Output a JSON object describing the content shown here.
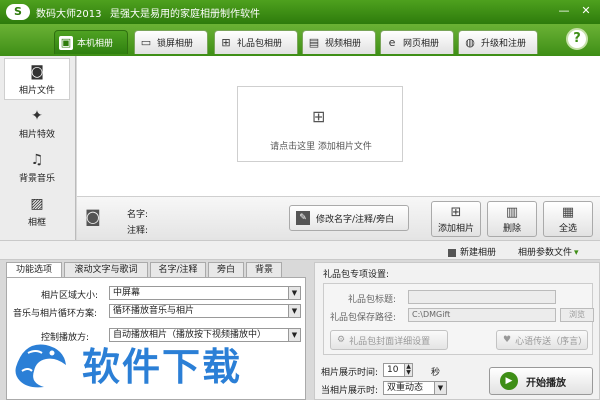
{
  "window": {
    "app_name": "数码大师2013",
    "slogan": "是强大是易用的家庭相册制作软件",
    "minimize": "—",
    "close": "✕"
  },
  "tabs": [
    {
      "label": "本机相册",
      "icon": "photo-album-icon",
      "active": true
    },
    {
      "label": "锁屏相册",
      "icon": "monitor-icon",
      "active": false
    },
    {
      "label": "礼品包相册",
      "icon": "gift-icon",
      "active": false
    },
    {
      "label": "视频相册",
      "icon": "film-icon",
      "active": false
    },
    {
      "label": "网页相册",
      "icon": "browser-icon",
      "active": false
    },
    {
      "label": "升级和注册",
      "icon": "globe-icon",
      "active": false
    }
  ],
  "help": "?",
  "sidebar": {
    "items": [
      {
        "label": "相片文件",
        "icon": "camera-icon",
        "active": true
      },
      {
        "label": "相片特效",
        "icon": "effects-icon",
        "active": false
      },
      {
        "label": "背景音乐",
        "icon": "music-icon",
        "active": false
      },
      {
        "label": "相框",
        "icon": "frame-icon",
        "active": false
      }
    ]
  },
  "dropzone": {
    "text": "请点击这里  添加相片文件"
  },
  "info": {
    "name_label": "名字:",
    "note_label": "注释:",
    "edit_button": "修改名字/注释/旁白",
    "add_photo": "添加相片",
    "delete": "删除",
    "select_all": "全选"
  },
  "sepbar": {
    "new_album": "新建相册",
    "album_params": "相册参数文件"
  },
  "bottom_left": {
    "tabs": [
      "功能选项",
      "滚动文字与歌词",
      "名字/注释",
      "旁白",
      "背景"
    ],
    "size_label": "相片区域大小:",
    "size_value": "中屏幕",
    "loop_label": "音乐与相片循环方案:",
    "loop_value": "循环播放音乐与相片",
    "control_label": "控制播放方:",
    "control_value": "自动播放相片（播放按下视频播放中）"
  },
  "bottom_right": {
    "title": "礼品包专项设置:",
    "gift_title_label": "礼品包标题:",
    "gift_title_value": "",
    "save_path_label": "礼品包保存路径:",
    "save_path_value": "C:\\DMGift",
    "browse": "浏览",
    "cover_button": "礼品包封面详细设置",
    "wish_button": "心语传送（序言）",
    "duration_label": "相片展示时间:",
    "duration_value": "10",
    "duration_unit": "秒",
    "transition_label": "当相片展示时:",
    "transition_value": "双重动态",
    "play_button": "开始播放"
  },
  "watermark": {
    "text": "软件下载"
  }
}
